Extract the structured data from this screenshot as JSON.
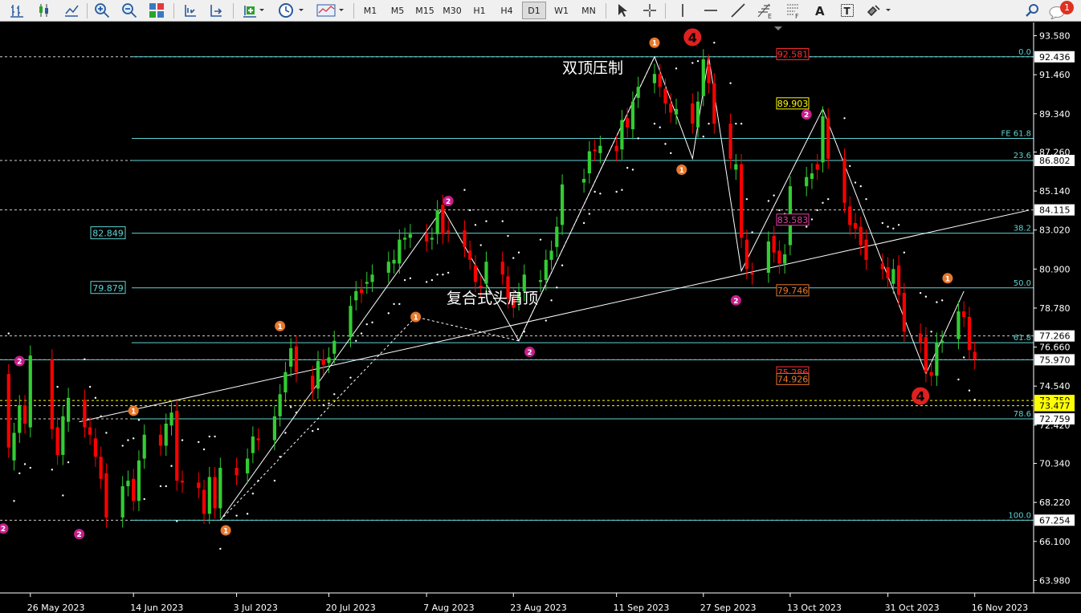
{
  "toolbar": {
    "timeframes": [
      "M1",
      "M5",
      "M15",
      "M30",
      "H1",
      "H4",
      "D1",
      "W1",
      "MN"
    ],
    "active_timeframe": "D1",
    "notification_count": "1",
    "icons": [
      "bar-chart-icon",
      "candlestick-icon",
      "line-chart-icon",
      "zoom-in-icon",
      "zoom-out-icon",
      "tile-windows-icon",
      "autoscroll-icon",
      "chart-shift-icon",
      "indicators-icon",
      "clock-icon",
      "templates-icon",
      "cursor-icon",
      "crosshair-icon",
      "vertical-line-icon",
      "horizontal-line-icon",
      "trendline-icon",
      "fibonacci-icon",
      "grid-tool-icon",
      "text-icon",
      "text-label-icon",
      "shapes-icon",
      "search-icon",
      "notification-icon"
    ]
  },
  "price_axis": {
    "ticks": [
      "93.580",
      "91.460",
      "89.340",
      "87.260",
      "85.140",
      "83.020",
      "80.900",
      "78.780",
      "76.660",
      "74.540",
      "72.420",
      "70.340",
      "68.220",
      "66.100",
      "63.980"
    ],
    "markers": [
      {
        "label": "92.436",
        "bg": "#ffffff",
        "fg": "#000000",
        "price": 92.436
      },
      {
        "label": "86.802",
        "bg": "#ffffff",
        "fg": "#000000",
        "price": 86.802
      },
      {
        "label": "84.115",
        "bg": "#ffffff",
        "fg": "#000000",
        "price": 84.115
      },
      {
        "label": "77.266",
        "bg": "#ffffff",
        "fg": "#000000",
        "price": 77.266
      },
      {
        "label": "75.970",
        "bg": "#ffffff",
        "fg": "#000000",
        "price": 75.97
      },
      {
        "label": "73.759",
        "bg": "#ffff00",
        "fg": "#000000",
        "price": 73.759
      },
      {
        "label": "73.477",
        "bg": "#ffff00",
        "fg": "#000000",
        "price": 73.477
      },
      {
        "label": "72.759",
        "bg": "#ffffff",
        "fg": "#000000",
        "price": 72.759
      },
      {
        "label": "67.254",
        "bg": "#ffffff",
        "fg": "#000000",
        "price": 67.254
      }
    ]
  },
  "date_axis": [
    "26 May 2023",
    "14 Jun 2023",
    "3 Jul 2023",
    "20 Jul 2023",
    "7 Aug 2023",
    "23 Aug 2023",
    "11 Sep 2023",
    "27 Sep 2023",
    "13 Oct 2023",
    "31 Oct 2023",
    "16 Nov 2023"
  ],
  "fib_levels": [
    {
      "label": "0.0",
      "price": 92.436
    },
    {
      "label": "FE 61.8",
      "price": 88.0
    },
    {
      "label": "23.6",
      "price": 86.802
    },
    {
      "label": "38.2",
      "price": 82.849
    },
    {
      "label": "50.0",
      "price": 79.879
    },
    {
      "label": "61.8",
      "price": 76.9
    },
    {
      "label": "78.6",
      "price": 72.759
    },
    {
      "label": "100.0",
      "price": 67.254
    }
  ],
  "level_boxes": [
    {
      "label": "82.849",
      "price": 82.849
    },
    {
      "label": "79.879",
      "price": 79.879
    }
  ],
  "price_labels": [
    {
      "label": "92.581",
      "color": "#ff3030",
      "price": 92.581
    },
    {
      "label": "89.903",
      "color": "#ffff00",
      "price": 89.903
    },
    {
      "label": "83.583",
      "color": "#e0409f",
      "price": 83.583
    },
    {
      "label": "79.746",
      "color": "#e8782a",
      "price": 79.746
    },
    {
      "label": "75.286",
      "color": "#ff3030",
      "price": 75.286
    },
    {
      "label": "74.926",
      "color": "#e8782a",
      "price": 74.926
    }
  ],
  "annotations": {
    "double_top": "双顶压制",
    "head_shoulders": "复合式头肩顶"
  },
  "wave_labels": [
    {
      "label": "4",
      "style": "big",
      "date": "2023-09-25",
      "price": 93.5
    },
    {
      "label": "4",
      "style": "big",
      "date": "2023-11-06",
      "price": 74.0
    },
    {
      "label": "1",
      "style": "small-orange",
      "date": "2023-09-18",
      "price": 93.2
    },
    {
      "label": "1",
      "style": "small-orange",
      "date": "2023-09-23",
      "price": 86.3
    },
    {
      "label": "1",
      "style": "small-orange",
      "date": "2023-07-11",
      "price": 77.8
    },
    {
      "label": "1",
      "style": "small-orange",
      "date": "2023-08-05",
      "price": 78.3
    },
    {
      "label": "1",
      "style": "small-orange",
      "date": "2023-06-14",
      "price": 73.2
    },
    {
      "label": "1",
      "style": "small-orange",
      "date": "2023-07-01",
      "price": 66.7
    },
    {
      "label": "1",
      "style": "small-orange",
      "date": "2023-11-11",
      "price": 80.4
    },
    {
      "label": "2",
      "style": "small-magenta",
      "date": "2023-05-24",
      "price": 75.9
    },
    {
      "label": "2",
      "style": "small-magenta",
      "date": "2023-05-21",
      "price": 66.8
    },
    {
      "label": "2",
      "style": "small-magenta",
      "date": "2023-06-04",
      "price": 66.5
    },
    {
      "label": "2",
      "style": "small-magenta",
      "date": "2023-08-11",
      "price": 84.6
    },
    {
      "label": "2",
      "style": "small-magenta",
      "date": "2023-08-26",
      "price": 76.4
    },
    {
      "label": "2",
      "style": "small-magenta",
      "date": "2023-10-03",
      "price": 79.2
    },
    {
      "label": "2",
      "style": "small-magenta",
      "date": "2023-10-16",
      "price": 89.3
    }
  ],
  "colors": {
    "bull": "#32cd32",
    "bear": "#ff0000",
    "background": "#000000",
    "fib": "#5fd3d3",
    "grid": "#ffffff"
  },
  "chart_data": {
    "type": "candlestick",
    "instrument_timeframe": "D1",
    "ylim": [
      63.3,
      94.3
    ],
    "x_range": [
      "2023-05-21",
      "2023-11-23"
    ],
    "series": [
      {
        "name": "",
        "points": [
          [
            "2023-05-22",
            75.2,
            71.2
          ],
          [
            "2023-05-23",
            70.5,
            72.0
          ],
          [
            "2023-05-24",
            72.0,
            73.5
          ],
          [
            "2023-05-25",
            73.5,
            72.5
          ],
          [
            "2023-05-26",
            72.3,
            76.2
          ],
          [
            "2023-05-30",
            76.0,
            72.2
          ],
          [
            "2023-05-31",
            72.3,
            70.8
          ],
          [
            "2023-06-01",
            70.8,
            72.9
          ],
          [
            "2023-06-02",
            72.6,
            73.9
          ],
          [
            "2023-06-05",
            73.8,
            72.3
          ],
          [
            "2023-06-06",
            72.3,
            71.9
          ],
          [
            "2023-06-07",
            71.7,
            70.7
          ],
          [
            "2023-06-08",
            70.7,
            69.5
          ],
          [
            "2023-06-09",
            69.8,
            67.4
          ],
          [
            "2023-06-12",
            67.4,
            69.1
          ],
          [
            "2023-06-13",
            69.1,
            69.4
          ],
          [
            "2023-06-14",
            69.5,
            68.3
          ],
          [
            "2023-06-15",
            68.3,
            70.5
          ],
          [
            "2023-06-16",
            70.6,
            71.9
          ],
          [
            "2023-06-19",
            71.9,
            71.3
          ],
          [
            "2023-06-20",
            71.3,
            72.5
          ],
          [
            "2023-06-21",
            72.4,
            73.1
          ],
          [
            "2023-06-22",
            73.2,
            69.4
          ],
          [
            "2023-06-23",
            69.4,
            69.3
          ],
          [
            "2023-06-26",
            69.3,
            69.0
          ],
          [
            "2023-06-27",
            68.9,
            67.6
          ],
          [
            "2023-06-28",
            67.6,
            69.6
          ],
          [
            "2023-06-29",
            69.6,
            67.9
          ],
          [
            "2023-06-30",
            67.9,
            70.1
          ],
          [
            "2023-07-03",
            70.1,
            69.7
          ],
          [
            "2023-07-05",
            69.8,
            70.6
          ],
          [
            "2023-07-06",
            70.9,
            71.8
          ],
          [
            "2023-07-07",
            71.7,
            71.6
          ],
          [
            "2023-07-10",
            71.6,
            72.9
          ],
          [
            "2023-07-11",
            72.9,
            74.1
          ],
          [
            "2023-07-12",
            74.2,
            75.3
          ],
          [
            "2023-07-13",
            75.6,
            76.6
          ],
          [
            "2023-07-14",
            76.7,
            75.3
          ],
          [
            "2023-07-17",
            75.1,
            74.3
          ],
          [
            "2023-07-18",
            74.4,
            75.9
          ],
          [
            "2023-07-19",
            76.0,
            75.7
          ],
          [
            "2023-07-20",
            75.8,
            76.1
          ],
          [
            "2023-07-21",
            76.3,
            77.0
          ],
          [
            "2023-07-24",
            77.2,
            78.9
          ],
          [
            "2023-07-25",
            79.2,
            79.7
          ],
          [
            "2023-07-26",
            79.8,
            79.6
          ],
          [
            "2023-07-27",
            80.1,
            80.2
          ],
          [
            "2023-07-28",
            80.2,
            80.6
          ],
          [
            "2023-07-31",
            80.7,
            81.3
          ],
          [
            "2023-08-01",
            81.2,
            81.4
          ],
          [
            "2023-08-02",
            81.2,
            82.5
          ],
          [
            "2023-08-03",
            82.5,
            82.6
          ],
          [
            "2023-08-04",
            82.6,
            82.8
          ],
          [
            "2023-08-07",
            82.8,
            82.4
          ],
          [
            "2023-08-08",
            82.5,
            82.6
          ],
          [
            "2023-08-09",
            82.8,
            84.1
          ],
          [
            "2023-08-10",
            84.4,
            82.8
          ],
          [
            "2023-08-11",
            83.0,
            82.9
          ],
          [
            "2023-08-14",
            83.0,
            82.1
          ],
          [
            "2023-08-15",
            81.9,
            81.4
          ],
          [
            "2023-08-16",
            81.1,
            80.2
          ],
          [
            "2023-08-17",
            80.0,
            79.9
          ],
          [
            "2023-08-18",
            80.1,
            81.3
          ],
          [
            "2023-08-21",
            81.3,
            80.6
          ],
          [
            "2023-08-22",
            80.5,
            79.3
          ],
          [
            "2023-08-23",
            79.3,
            78.8
          ],
          [
            "2023-08-24",
            79.2,
            79.6
          ],
          [
            "2023-08-25",
            79.7,
            80.6
          ],
          [
            "2023-08-28",
            80.2,
            80.3
          ],
          [
            "2023-08-29",
            80.3,
            81.4
          ],
          [
            "2023-08-30",
            81.4,
            81.9
          ],
          [
            "2023-08-31",
            82.1,
            83.2
          ],
          [
            "2023-09-01",
            83.3,
            85.5
          ],
          [
            "2023-09-05",
            85.6,
            85.8
          ],
          [
            "2023-09-06",
            86.1,
            87.3
          ],
          [
            "2023-09-07",
            87.4,
            87.3
          ],
          [
            "2023-09-08",
            87.2,
            87.6
          ],
          [
            "2023-09-11",
            87.6,
            87.3
          ],
          [
            "2023-09-12",
            87.4,
            89.0
          ],
          [
            "2023-09-13",
            89.1,
            88.6
          ],
          [
            "2023-09-14",
            88.5,
            90.0
          ],
          [
            "2023-09-15",
            90.2,
            90.8
          ],
          [
            "2023-09-18",
            91.0,
            91.5
          ],
          [
            "2023-09-19",
            91.5,
            90.8
          ],
          [
            "2023-09-20",
            90.7,
            89.9
          ],
          [
            "2023-09-21",
            89.9,
            89.4
          ],
          [
            "2023-09-22",
            89.3,
            89.6
          ],
          [
            "2023-09-25",
            89.9,
            88.8
          ],
          [
            "2023-09-26",
            88.6,
            90.0
          ],
          [
            "2023-09-27",
            90.3,
            92.3
          ],
          [
            "2023-09-28",
            92.0,
            91.0
          ],
          [
            "2023-09-29",
            91.0,
            88.8
          ],
          [
            "2023-10-02",
            88.8,
            86.9
          ],
          [
            "2023-10-03",
            86.3,
            86.6
          ],
          [
            "2023-10-04",
            86.6,
            82.6
          ],
          [
            "2023-10-05",
            82.5,
            80.9
          ],
          [
            "2023-10-06",
            80.7,
            80.6
          ],
          [
            "2023-10-09",
            80.7,
            82.4
          ],
          [
            "2023-10-10",
            82.7,
            81.8
          ],
          [
            "2023-10-11",
            81.9,
            81.2
          ],
          [
            "2023-10-12",
            81.2,
            81.7
          ],
          [
            "2023-10-13",
            82.2,
            85.4
          ],
          [
            "2023-10-16",
            85.4,
            85.9
          ],
          [
            "2023-10-17",
            85.8,
            86.1
          ],
          [
            "2023-10-18",
            86.6,
            86.3
          ],
          [
            "2023-10-19",
            86.7,
            89.2
          ],
          [
            "2023-10-20",
            89.1,
            86.9
          ],
          [
            "2023-10-23",
            86.9,
            84.5
          ],
          [
            "2023-10-24",
            84.3,
            83.3
          ],
          [
            "2023-10-25",
            83.4,
            83.1
          ],
          [
            "2023-10-26",
            83.2,
            82.2
          ],
          [
            "2023-10-27",
            82.5,
            81.4
          ],
          [
            "2023-10-30",
            81.2,
            80.9
          ],
          [
            "2023-10-31",
            81.0,
            80.4
          ],
          [
            "2023-11-01",
            80.1,
            80.9
          ],
          [
            "2023-11-02",
            81.1,
            79.5
          ],
          [
            "2023-11-03",
            79.6,
            77.5
          ],
          [
            "2023-11-06",
            77.4,
            76.9
          ],
          [
            "2023-11-07",
            77.2,
            75.3
          ],
          [
            "2023-11-08",
            75.3,
            75.1
          ],
          [
            "2023-11-09",
            75.1,
            76.9
          ],
          [
            "2023-11-10",
            76.9,
            77.0
          ],
          [
            "2023-11-13",
            77.1,
            78.6
          ],
          [
            "2023-11-14",
            78.6,
            78.3
          ],
          [
            "2023-11-15",
            78.3,
            76.5
          ],
          [
            "2023-11-16",
            76.4,
            76.0
          ]
        ]
      }
    ],
    "candle_format": [
      "date",
      "open",
      "close"
    ]
  }
}
